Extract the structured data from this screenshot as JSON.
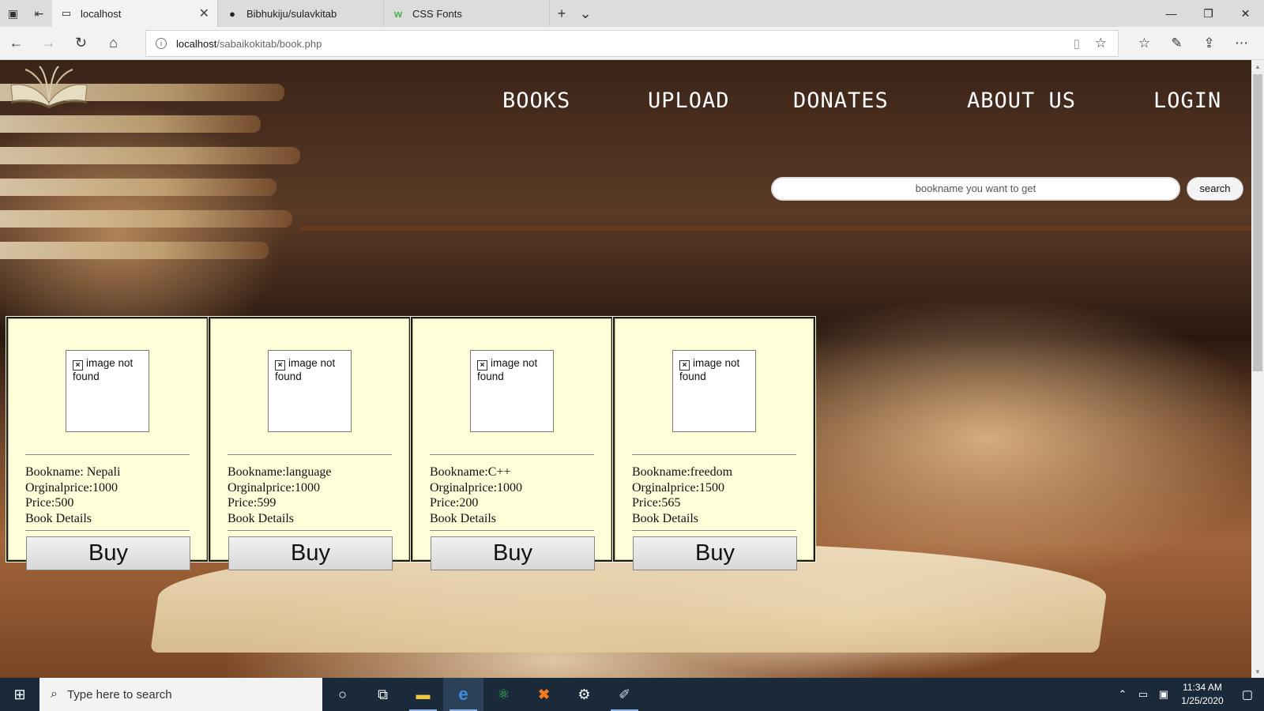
{
  "browser": {
    "tabs": [
      {
        "title": "localhost",
        "icon": "page-icon",
        "active": true
      },
      {
        "title": "Bibhukiju/sulavkitab",
        "icon": "github-icon",
        "active": false
      },
      {
        "title": "CSS Fonts",
        "icon": "w3schools-icon",
        "active": false
      }
    ],
    "address": {
      "host": "localhost",
      "path": "/sabaikokitab/book.php"
    }
  },
  "site": {
    "menu": [
      "BOOKS",
      "UPLOAD",
      "DONATES",
      "ABOUT US",
      "LOGIN"
    ],
    "search": {
      "placeholder": "bookname you want to get",
      "button": "search"
    },
    "books": [
      {
        "img_alt": "image not found",
        "name": "Bookname: Nepali",
        "original": "Orginalprice:1000",
        "price": "Price:500",
        "details": "Book Details",
        "buy": "Buy"
      },
      {
        "img_alt": "image not found",
        "name": "Bookname:language",
        "original": "Orginalprice:1000",
        "price": "Price:599",
        "details": "Book Details",
        "buy": "Buy"
      },
      {
        "img_alt": "image not found",
        "name": "Bookname:C++",
        "original": "Orginalprice:1000",
        "price": "Price:200",
        "details": "Book Details",
        "buy": "Buy"
      },
      {
        "img_alt": "image not found",
        "name": "Bookname:freedom",
        "original": "Orginalprice:1500",
        "price": "Price:565",
        "details": "Book Details",
        "buy": "Buy"
      }
    ]
  },
  "taskbar": {
    "search_placeholder": "Type here to search",
    "time": "11:34 AM",
    "date": "1/25/2020"
  },
  "colors": {
    "card_bg": "#fefed9",
    "taskbar_bg": "#1b2a3a"
  }
}
